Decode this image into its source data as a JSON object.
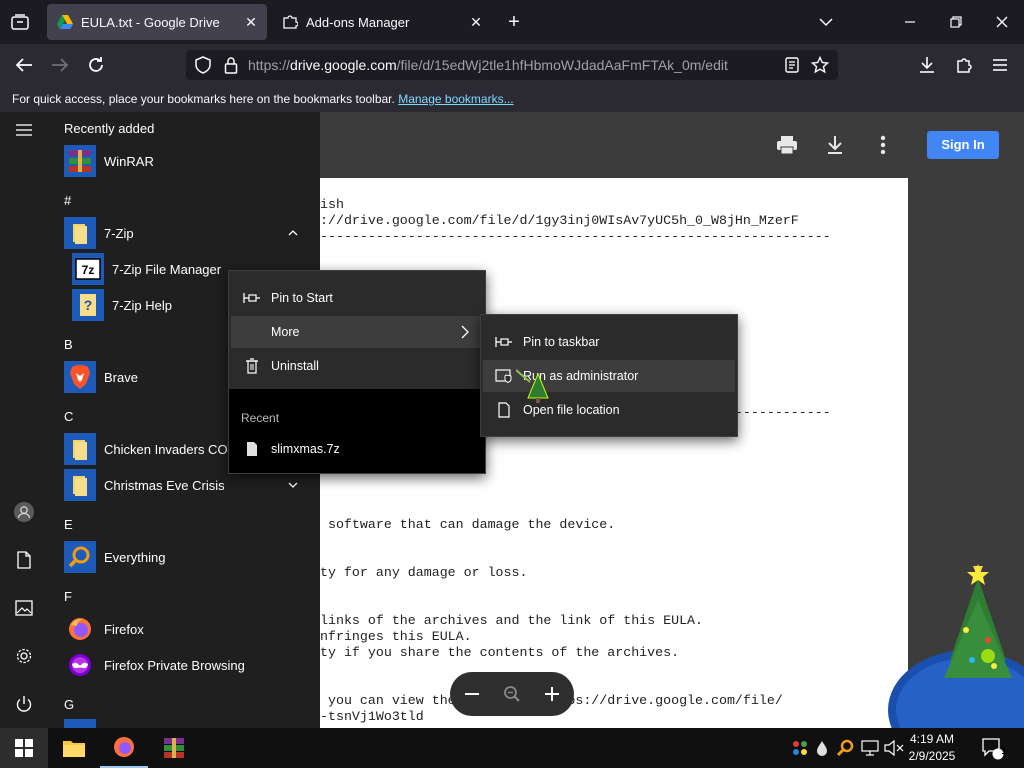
{
  "browser": {
    "tabs": [
      {
        "title": "EULA.txt - Google Drive",
        "active": true,
        "icon": "google-drive-icon"
      },
      {
        "title": "Add-ons Manager",
        "active": false,
        "icon": "puzzle-icon"
      }
    ],
    "url": {
      "prefix": "https://",
      "host": "drive.google.com",
      "path": "/file/d/15edWj2tle1hfHbmoWJdadAaFmFTAk_0m/edit"
    },
    "bookmarks_bar": {
      "text": "For quick access, place your bookmarks here on the bookmarks toolbar.",
      "link": "Manage bookmarks..."
    }
  },
  "drive": {
    "sign_in": "Sign In",
    "doc_lines": [
      "ish",
      "://drive.google.com/file/d/1gy3inj0WIsAv7yUC5h_0_W8jHn_MzerF",
      "----------------------------------------------------------------",
      "----------------------------------------------------------------",
      " software that can damage the device.",
      "ty for any damage or loss.",
      "links of the archives and the link of this EULA.",
      "nfringes this EULA.",
      "ty if you share the contents of the archives.",
      " you can view the password: https://drive.google.com/file/",
      "-tsnVj1Wo3tld"
    ]
  },
  "start_menu": {
    "recently_added_label": "Recently added",
    "letters": [
      "#",
      "B",
      "C",
      "E",
      "F",
      "G"
    ],
    "apps": {
      "winrar": "WinRAR",
      "sevenzip": "7-Zip",
      "sevenzip_fm": "7-Zip File Manager",
      "sevenzip_help": "7-Zip Help",
      "brave": "Brave",
      "chicken": "Chicken Invaders COTD",
      "xmas": "Christmas Eve Crisis",
      "everything": "Everything",
      "firefox": "Firefox",
      "firefox_private": "Firefox Private Browsing"
    }
  },
  "context_menu": {
    "pin_to_start": "Pin to Start",
    "more": "More",
    "uninstall": "Uninstall",
    "recent_header": "Recent",
    "recent_file": "slimxmas.7z"
  },
  "submenu": {
    "pin_to_taskbar": "Pin to taskbar",
    "run_as_admin": "Run as administrator",
    "open_file_location": "Open file location"
  },
  "taskbar": {
    "time": "4:19 AM",
    "date": "2/9/2025",
    "notification_count": "1"
  }
}
